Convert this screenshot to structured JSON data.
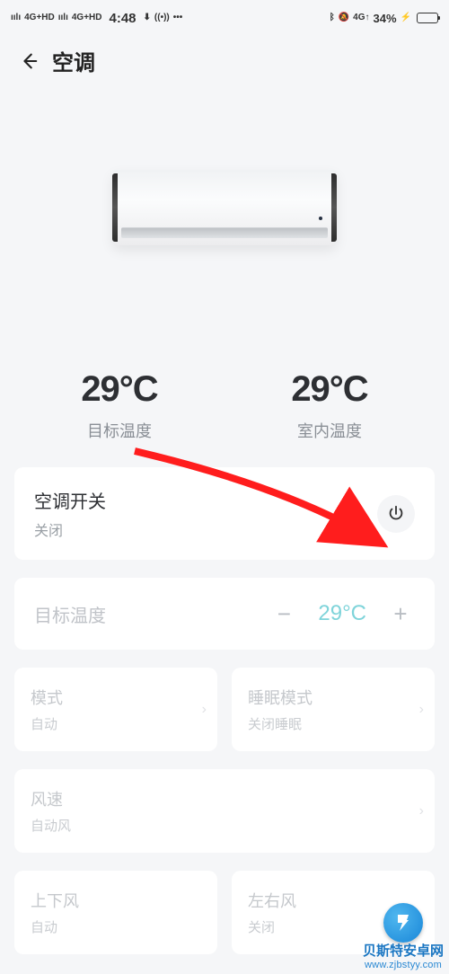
{
  "statusbar": {
    "net1": "4G+HD",
    "net2": "4G+HD",
    "time": "4:48",
    "bt": "✱",
    "dnd": "✕",
    "net_right": "4G↑",
    "batt_pct": "34%"
  },
  "nav": {
    "title": "空调"
  },
  "readouts": {
    "target": {
      "value": "29°C",
      "label": "目标温度"
    },
    "indoor": {
      "value": "29°C",
      "label": "室内温度"
    }
  },
  "power": {
    "title": "空调开关",
    "state": "关闭"
  },
  "target_card": {
    "label": "目标温度",
    "value": "29°C"
  },
  "cards": {
    "mode": {
      "title": "模式",
      "sub": "自动"
    },
    "sleep": {
      "title": "睡眠模式",
      "sub": "关闭睡眠"
    },
    "fan": {
      "title": "风速",
      "sub": "自动风"
    },
    "vswing": {
      "title": "上下风",
      "sub": "自动"
    },
    "hswing": {
      "title": "左右风",
      "sub": "关闭"
    }
  },
  "watermark": {
    "name": "贝斯特安卓网",
    "url": "www.zjbstyy.com"
  }
}
